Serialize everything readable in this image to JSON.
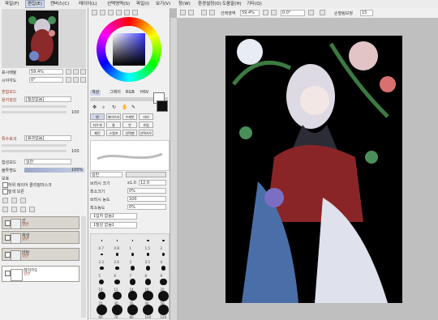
{
  "menu": {
    "items": [
      "파일(F)",
      "편집(E)",
      "캔버스(C)",
      "레이어(L)",
      "선택영역(S)",
      "파일(I)",
      "보기(V)",
      "창(W)",
      "환경설정(O)",
      "도움말(H)",
      "기타(Q)"
    ],
    "active_index": 1
  },
  "navigator": {
    "zoom_label": "표시배율",
    "zoom_value": "59.4%",
    "angle_label": "시야각도",
    "angle_value": "0°"
  },
  "toolbar": {
    "selection_label": "선택영역",
    "zoom_value": "59.4%",
    "angle_value": "0.0°",
    "stabilizer_label": "손떨림보정",
    "stabilizer_value": "15"
  },
  "left_panel": {
    "section_title": "혼합모드",
    "texture_label": "용지질감",
    "texture_value": "[질감없음]",
    "texture_strength": "100",
    "effect_label": "특수효과",
    "effect_value": "[효과없음]",
    "effect_strength": "100",
    "blend_label": "합성모드",
    "blend_value": "일반",
    "opacity_label": "불투명도",
    "opacity_value": "100%",
    "protect_label": "보호",
    "clip_label": "하위 레이어 클리핑마스크",
    "mask_label": "밑색 보존"
  },
  "layers": [
    {
      "name": "선",
      "mode": "일반",
      "opacity": "100%"
    },
    {
      "name": "채색",
      "mode": "일반",
      "opacity": "100%"
    },
    {
      "name": "바탕",
      "mode": "일반",
      "opacity": "100%"
    },
    {
      "name": "레이어1",
      "mode": "일반",
      "opacity": "100%"
    }
  ],
  "color_tabs": [
    "색상",
    "그레이",
    "RGB",
    "HSV"
  ],
  "tools": [
    "펜",
    "에어브러시",
    "수채붓",
    "마커",
    "지우개",
    "물",
    "붓",
    "흐림",
    "패턴",
    "스탬프",
    "선택펜",
    "선택지우개"
  ],
  "brush": {
    "preset_label": "일반",
    "size_label": "브러시 크기",
    "size_mult": "x1.0",
    "size_value": "12.0",
    "min_size_label": "최소크기",
    "min_size_value": "0%",
    "density_label": "브러시 농도",
    "density_value": "100",
    "min_density_label": "최소농도",
    "min_density_value": "0%",
    "shape_label": "【입자 없음】",
    "texture_label": "【질감 없음】"
  },
  "brush_sizes": [
    [
      "0.7",
      "0.8",
      "1",
      "1.5",
      "2"
    ],
    [
      "2.3",
      "2.6",
      "3",
      "3.5",
      "4"
    ],
    [
      "5",
      "6",
      "7",
      "8",
      "9"
    ],
    [
      "10",
      "12",
      "14",
      "16",
      "20"
    ],
    [
      "25",
      "30",
      "35",
      "40",
      "50"
    ],
    [
      "60",
      "70",
      "80",
      "100",
      "120"
    ]
  ],
  "colors": {
    "accent": "#3a66d6",
    "primary": "#1a1a2e"
  }
}
